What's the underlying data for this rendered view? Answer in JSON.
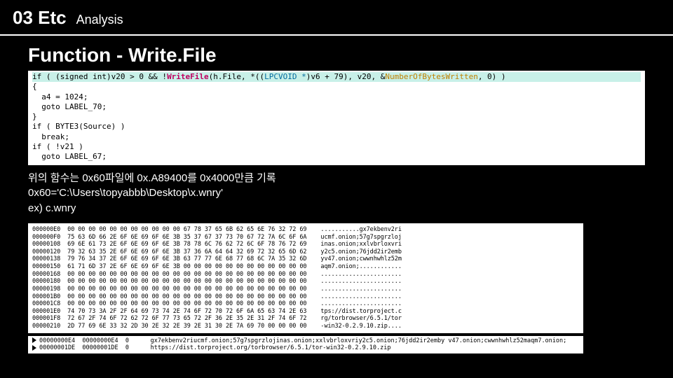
{
  "header": {
    "num": "03 Etc",
    "sub": "Analysis"
  },
  "section_title": "Function - Write.File",
  "code": {
    "line1_pre": "if ( (signed int)v20 > 0 && !",
    "line1_call": "WriteFile",
    "line1_mid1": "(h.File, *((",
    "line1_cast": "LPCVOID *",
    "line1_mid2": ")v6 + 79), v20, &",
    "line1_arg": "NumberOfBytesWritten",
    "line1_end": ", 0) )",
    "line2": "{",
    "line3": "  a4 = 1024;",
    "line4": "  goto LABEL_70;",
    "line5": "}",
    "line6": "if ( BYTE3(Source) )",
    "line7": "  break;",
    "line8": "if ( !v21 )",
    "line9": "  goto LABEL_67;"
  },
  "body_text": {
    "l1": "위의 함수는 0x60파일에 0x.A89400를 0x4000만큼 기록",
    "l2": "0x60='C:\\Users\\topyabbb\\Desktop\\x.wnry'",
    "l3": "ex) c.wnry"
  },
  "hex": {
    "rows": [
      {
        "addr": "000000E0",
        "b": "00 00 00 00 00 00 00 00 00 00 00 67 78 37 65 6B 62 65 6E 76 32 72 69",
        "asc": "...........gx7ekbenv2ri"
      },
      {
        "addr": "000000F0",
        "b": "75 63 6D 66 2E 6F 6E 69 6F 6E 3B 35 37 67 37 73 70 67 72 7A 6C 6F 6A",
        "asc": "ucmf.onion;57g7spgrzloj"
      },
      {
        "addr": "00000108",
        "b": "69 6E 61 73 2E 6F 6E 69 6F 6E 3B 78 78 6C 76 62 72 6C 6F 78 76 72 69",
        "asc": "inas.onion;xxlvbrloxvri"
      },
      {
        "addr": "00000120",
        "b": "79 32 63 35 2E 6F 6E 69 6F 6E 3B 37 36 6A 64 64 32 69 72 32 65 6D 62",
        "asc": "y2c5.onion;76jdd2ir2emb"
      },
      {
        "addr": "00000138",
        "b": "79 76 34 37 2E 6F 6E 69 6F 6E 3B 63 77 77 6E 68 77 68 6C 7A 35 32 6D",
        "asc": "yv47.onion;cwwnhwhlz52m"
      },
      {
        "addr": "00000150",
        "b": "61 71 6D 37 2E 6F 6E 69 6F 6E 3B 00 00 00 00 00 00 00 00 00 00 00 00",
        "asc": "aqm7.onion;............"
      },
      {
        "addr": "00000168",
        "b": "00 00 00 00 00 00 00 00 00 00 00 00 00 00 00 00 00 00 00 00 00 00 00",
        "asc": "......................."
      },
      {
        "addr": "00000180",
        "b": "00 00 00 00 00 00 00 00 00 00 00 00 00 00 00 00 00 00 00 00 00 00 00",
        "asc": "......................."
      },
      {
        "addr": "00000198",
        "b": "00 00 00 00 00 00 00 00 00 00 00 00 00 00 00 00 00 00 00 00 00 00 00",
        "asc": "......................."
      },
      {
        "addr": "000001B0",
        "b": "00 00 00 00 00 00 00 00 00 00 00 00 00 00 00 00 00 00 00 00 00 00 00",
        "asc": "......................."
      },
      {
        "addr": "000001C8",
        "b": "00 00 00 00 00 00 00 00 00 00 00 00 00 00 00 00 00 00 00 00 00 00 00",
        "asc": "......................."
      },
      {
        "addr": "000001E0",
        "b": "74 70 73 3A 2F 2F 64 69 73 74 2E 74 6F 72 70 72 6F 6A 65 63 74 2E 63",
        "asc": "tps://dist.torproject.c"
      },
      {
        "addr": "000001F8",
        "b": "72 67 2F 74 6F 72 62 72 6F 77 73 65 72 2F 36 2E 35 2E 31 2F 74 6F 72",
        "asc": "rg/torbrowser/6.5.1/tor"
      },
      {
        "addr": "00000210",
        "b": "2D 77 69 6E 33 32 2D 30 2E 32 2E 39 2E 31 30 2E 7A 69 70 00 00 00 00",
        "asc": "-win32-0.2.9.10.zip...."
      }
    ]
  },
  "footer": {
    "row1_a": "00000000E4  00000000E4  0      gx7ekbenv2riucmf.onion;57g7spgrzlojinas.onion;xxlvbrloxvriy2c5.onion;76jdd2ir2emby v47.onion;cwwnhwhlz52maqm7.onion;",
    "row2_a": "00000001DE  00000001DE  0      https://dist.torproject.org/torbrowser/6.5.1/tor-win32-0.2.9.10.zip"
  }
}
